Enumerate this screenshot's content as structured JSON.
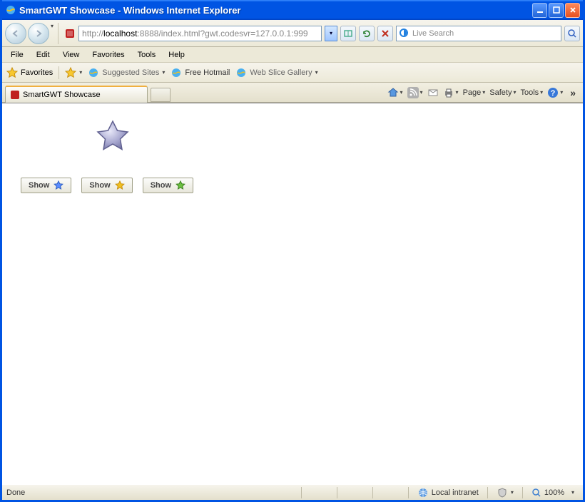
{
  "window": {
    "title": "SmartGWT Showcase - Windows Internet Explorer"
  },
  "address": {
    "prefix": "http://",
    "host": "localhost",
    "rest": ":8888/index.html?gwt.codesvr=127.0.0.1:999"
  },
  "search": {
    "placeholder": "Live Search"
  },
  "menu": {
    "file": "File",
    "edit": "Edit",
    "view": "View",
    "favorites": "Favorites",
    "tools": "Tools",
    "help": "Help"
  },
  "favbar": {
    "label": "Favorites",
    "suggested": "Suggested Sites",
    "hotmail": "Free Hotmail",
    "webslice": "Web Slice Gallery"
  },
  "tab": {
    "title": "SmartGWT Showcase"
  },
  "cmdbar": {
    "page": "Page",
    "safety": "Safety",
    "tools": "Tools"
  },
  "content": {
    "buttons": [
      {
        "label": "Show",
        "star": "#5a8cff"
      },
      {
        "label": "Show",
        "star": "#f0c020"
      },
      {
        "label": "Show",
        "star": "#6cc040"
      }
    ]
  },
  "status": {
    "left": "Done",
    "zone": "Local intranet",
    "zoom": "100%"
  }
}
